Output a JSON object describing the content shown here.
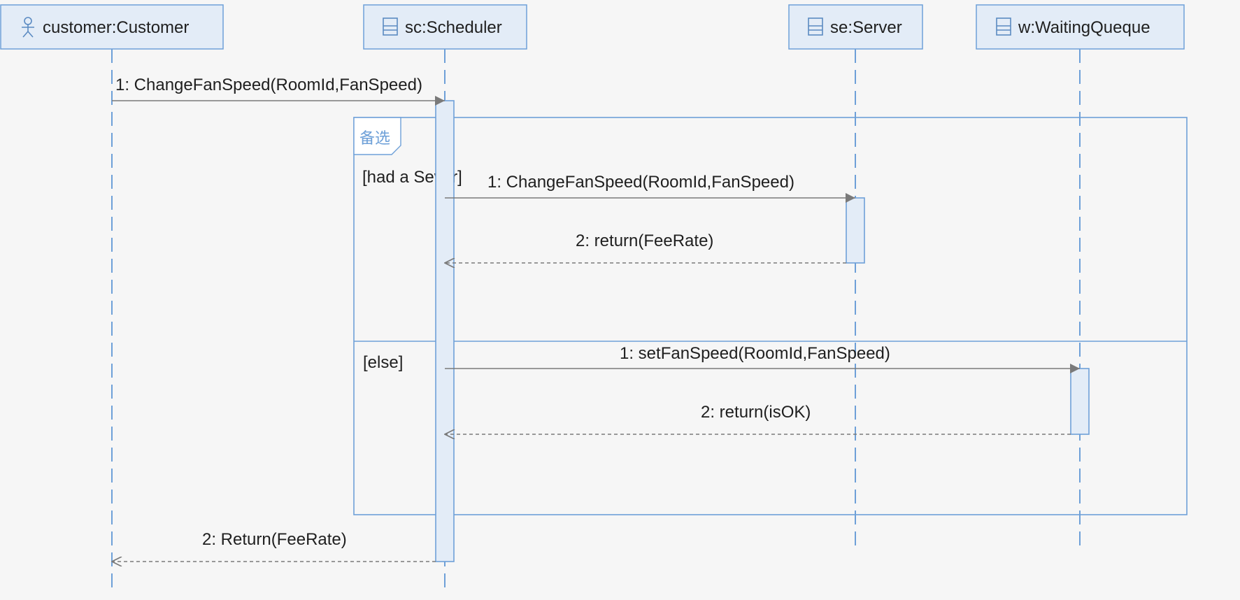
{
  "participants": [
    {
      "id": "customer",
      "label": "customer:Customer",
      "icon": "actor-icon"
    },
    {
      "id": "sc",
      "label": "sc:Scheduler",
      "icon": "class-icon"
    },
    {
      "id": "se",
      "label": "se:Server",
      "icon": "class-icon"
    },
    {
      "id": "w",
      "label": "w:WaitingQueque",
      "icon": "class-icon"
    }
  ],
  "messages": {
    "m1": "1: ChangeFanSpeed(RoomId,FanSpeed)",
    "alt1_call": "1: ChangeFanSpeed(RoomId,FanSpeed)",
    "alt1_return": "2: return(FeeRate)",
    "alt2_call": "1: setFanSpeed(RoomId,FanSpeed)",
    "alt2_return": "2: return(isOK)",
    "final_return": "2: Return(FeeRate)"
  },
  "fragment": {
    "operator": "备选",
    "guard1": "[had a Sever]",
    "guard2": "[else]"
  },
  "colors": {
    "background": "#f6f6f6",
    "box_fill": "#e3ecf7",
    "box_border": "#6ea0d8",
    "arrow": "#7a7a7a",
    "text": "#1f1f1f"
  }
}
